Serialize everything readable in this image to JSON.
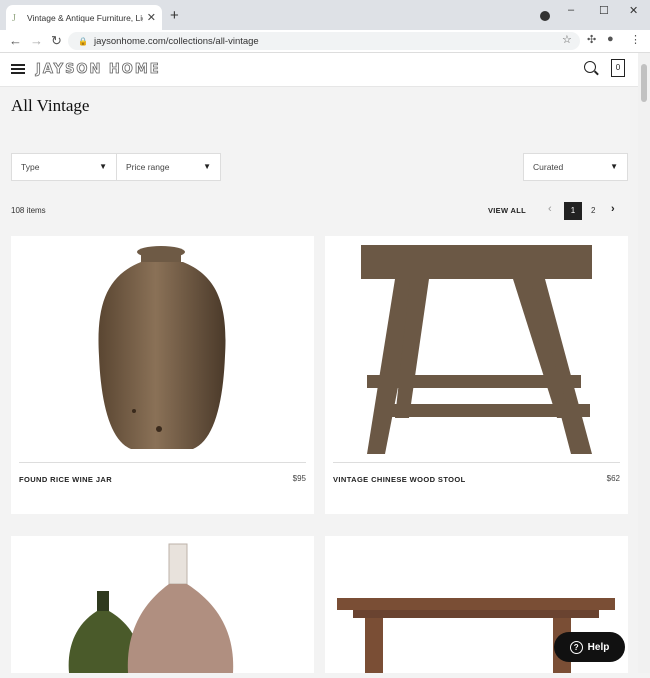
{
  "browser": {
    "tab_title": "Vintage & Antique Furniture, Lig",
    "tab_close": "✕",
    "new_tab": "+",
    "url": "jaysonhome.com/collections/all-vintage",
    "window_min": "–",
    "window_max": "☐",
    "window_close": "✕"
  },
  "site": {
    "logo": "JAYSON HOME",
    "cart_count": "0"
  },
  "page": {
    "title": "All Vintage"
  },
  "filters": {
    "type_label": "Type",
    "price_label": "Price range",
    "sort_label": "Curated"
  },
  "listing": {
    "count": "108 items",
    "view_all": "VIEW ALL",
    "pages": [
      "1",
      "2"
    ],
    "current_page": 1
  },
  "products": [
    {
      "name": "FOUND RICE WINE JAR",
      "price": "$95"
    },
    {
      "name": "VINTAGE CHINESE WOOD STOOL",
      "price": "$62"
    }
  ],
  "help": {
    "label": "Help"
  },
  "colors": {
    "accent": "#222222",
    "background": "#f3f3f3"
  }
}
